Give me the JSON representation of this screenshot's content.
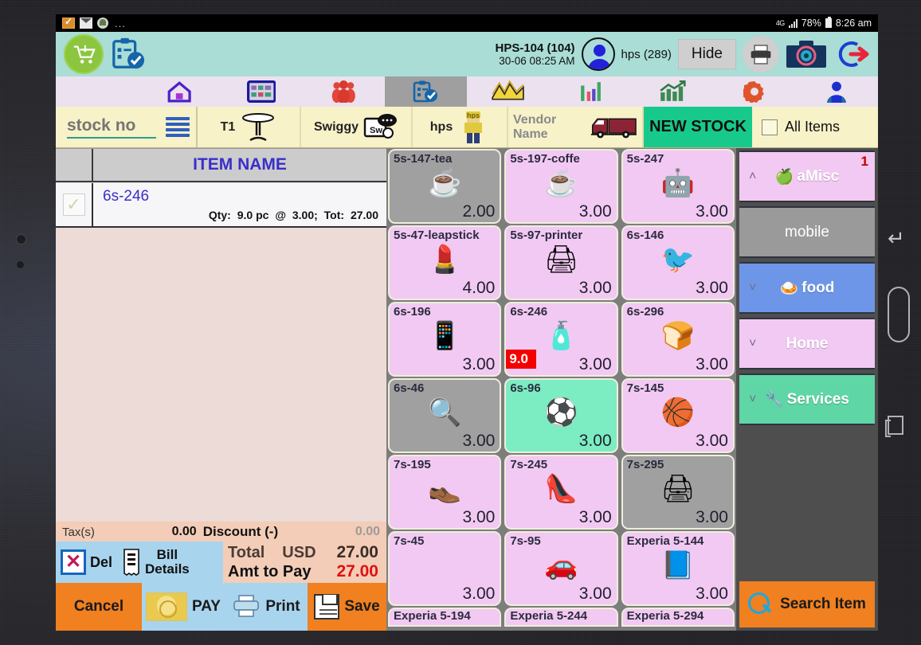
{
  "status_bar": {
    "icons": [
      "checkbox-app-icon",
      "mail-icon",
      "contact-icon",
      "overflow-dots"
    ],
    "dots": "...",
    "network": "4G",
    "battery": "78%",
    "time": "8:26 am"
  },
  "app_bar": {
    "cart_icon": "shopping-cart-icon",
    "clipboard_icon": "clipboard-check-icon",
    "bill_no": "HPS-104 (104)",
    "bill_date": "30-06 08:25 AM",
    "user": "hps (289)",
    "hide_label": "Hide",
    "print_icon": "printer-icon",
    "camera_icon": "camera-icon",
    "logout_icon": "logout-arrow-icon"
  },
  "icon_nav": [
    {
      "name": "home",
      "icon": "home-icon",
      "active": false
    },
    {
      "name": "tables",
      "icon": "grid-table-icon",
      "active": false
    },
    {
      "name": "customers",
      "icon": "people-icon",
      "active": false
    },
    {
      "name": "orders",
      "icon": "clipboard-check-icon",
      "active": true
    },
    {
      "name": "cash",
      "icon": "money-stack-icon",
      "active": false
    },
    {
      "name": "reports-bar",
      "icon": "bar-chart-icon",
      "active": false
    },
    {
      "name": "reports-trend",
      "icon": "trend-chart-icon",
      "active": false
    },
    {
      "name": "settings",
      "icon": "gear-icon",
      "active": false
    },
    {
      "name": "profile",
      "icon": "user-icon",
      "active": false
    }
  ],
  "filter_bar": {
    "stock_value": "stock no",
    "stock_placeholder": "stock no",
    "list_icon": "list-lines-icon",
    "tabs": [
      {
        "label": "T1",
        "icon": "table-icon"
      },
      {
        "label": "Swiggy",
        "icon": "swiggy-icon"
      },
      {
        "label": "hps",
        "icon": "person-icon"
      },
      {
        "label": "Vendor Name",
        "icon": "truck-icon",
        "muted": true
      }
    ],
    "new_stock_label": "NEW STOCK",
    "all_items_label": "All Items",
    "all_items_checked": false
  },
  "bill": {
    "header": "ITEM NAME",
    "rows": [
      {
        "name": "6s-246",
        "qty_label": "Qty:",
        "qty": "9.0 pc",
        "rate_label": "@",
        "rate": "3.00;",
        "tot_label": "Tot:",
        "total": "27.00",
        "checked": true
      }
    ],
    "tax_label": "Tax(s)",
    "tax_value": "0.00",
    "discount_label": "Discount (-)",
    "discount_value": "0.00",
    "total_label": "Total",
    "currency": "USD",
    "total_value": "27.00",
    "amt_label": "Amt to Pay",
    "amt_value": "27.00",
    "del_label": "Del",
    "bill_details_label": "Bill\nDetails",
    "bill_details_line1": "Bill",
    "bill_details_line2": "Details",
    "actions": {
      "cancel": "Cancel",
      "pay": "PAY",
      "print": "Print",
      "save": "Save"
    }
  },
  "grid": {
    "tiles": [
      {
        "name": "5s-147-tea",
        "price": "2.00",
        "art": "☕",
        "state": "grey"
      },
      {
        "name": "5s-197-coffe",
        "price": "3.00",
        "art": "☕",
        "state": "pink"
      },
      {
        "name": "5s-247",
        "price": "3.00",
        "art": "🤖",
        "state": "pink"
      },
      {
        "name": "5s-47-leapstick",
        "price": "4.00",
        "art": "💄",
        "state": "pink"
      },
      {
        "name": "5s-97-printer",
        "price": "3.00",
        "art": "🖨",
        "state": "pink"
      },
      {
        "name": "6s-146",
        "price": "3.00",
        "art": "🐦",
        "state": "pink"
      },
      {
        "name": "6s-196",
        "price": "3.00",
        "art": "📱",
        "state": "pink"
      },
      {
        "name": "6s-246",
        "price": "3.00",
        "art": "🧴",
        "state": "pink",
        "qty": "9.0"
      },
      {
        "name": "6s-296",
        "price": "3.00",
        "art": "🍞",
        "state": "pink"
      },
      {
        "name": "6s-46",
        "price": "3.00",
        "art": "🔍",
        "state": "grey"
      },
      {
        "name": "6s-96",
        "price": "3.00",
        "art": "⚽",
        "state": "green"
      },
      {
        "name": "7s-145",
        "price": "3.00",
        "art": "🏀",
        "state": "pink"
      },
      {
        "name": "7s-195",
        "price": "3.00",
        "art": "👞",
        "state": "pink"
      },
      {
        "name": "7s-245",
        "price": "3.00",
        "art": "👠",
        "state": "pink"
      },
      {
        "name": "7s-295",
        "price": "3.00",
        "art": "🖨",
        "state": "grey"
      },
      {
        "name": "7s-45",
        "price": "3.00",
        "art": "",
        "state": "pink"
      },
      {
        "name": "7s-95",
        "price": "3.00",
        "art": "🚗",
        "state": "pink"
      },
      {
        "name": "Experia 5-144",
        "price": "3.00",
        "art": "📘",
        "state": "pink"
      }
    ],
    "partial_tiles": [
      {
        "name": "Experia 5-194"
      },
      {
        "name": "Experia 5-244"
      },
      {
        "name": "Experia 5-294"
      }
    ]
  },
  "categories": [
    {
      "id": "misc",
      "label": "aMisc",
      "emoji": "🍏",
      "chevron": "˄",
      "badge": "1",
      "color": "#f2c9f2"
    },
    {
      "id": "mobile",
      "label": "mobile",
      "emoji": "",
      "chevron": "",
      "badge": "",
      "color": "#9a9a9a"
    },
    {
      "id": "food",
      "label": "food",
      "emoji": "🍛",
      "chevron": "˅",
      "badge": "",
      "color": "#6e96e8"
    },
    {
      "id": "home",
      "label": "Home",
      "emoji": "",
      "chevron": "˅",
      "badge": "",
      "color": "#f2c9f2"
    },
    {
      "id": "services",
      "label": "Services",
      "emoji": "🔧",
      "chevron": "˅",
      "badge": "",
      "color": "#5fd6a5"
    }
  ],
  "search_item": {
    "label": "Search Item",
    "icon": "magnifier-icon"
  },
  "device": {
    "nav_back_icon": "back-arrow-icon",
    "nav_home_icon": "home-pill-icon",
    "nav_recent_icon": "recents-icon"
  },
  "colors": {
    "appbar": "#a9ddd6",
    "accent_orange": "#f08020",
    "new_stock_green": "#17ca8c",
    "selected_green": "#7cecc2",
    "tile_pink": "#f2c9f2",
    "qty_red": "#f40000",
    "total_red": "#e01010",
    "item_blue": "#3a2fc9"
  }
}
